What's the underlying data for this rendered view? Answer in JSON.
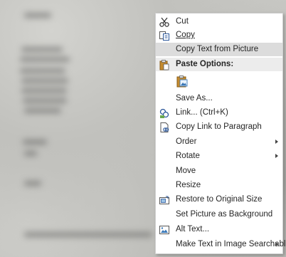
{
  "context_menu": {
    "items": [
      {
        "label": "Cut",
        "icon": "scissors-icon"
      },
      {
        "label": "Copy",
        "icon": "copy-icon"
      },
      {
        "label": "Copy Text from Picture",
        "icon": ""
      },
      {
        "label": "Paste Options:",
        "icon": "clipboard-icon"
      },
      {
        "label": "",
        "icon": "paste-picture-icon"
      },
      {
        "label": "Save As...",
        "icon": ""
      },
      {
        "label": "Link...  (Ctrl+K)",
        "icon": "link-icon"
      },
      {
        "label": "Copy Link to Paragraph",
        "icon": "document-link-icon"
      },
      {
        "label": "Order",
        "icon": ""
      },
      {
        "label": "Rotate",
        "icon": ""
      },
      {
        "label": "Move",
        "icon": ""
      },
      {
        "label": "Resize",
        "icon": ""
      },
      {
        "label": "Restore to Original Size",
        "icon": "restore-size-icon"
      },
      {
        "label": "Set Picture as Background",
        "icon": ""
      },
      {
        "label": "Alt Text...",
        "icon": "alt-text-icon"
      },
      {
        "label": "Make Text in Image Searchable",
        "icon": ""
      }
    ]
  }
}
